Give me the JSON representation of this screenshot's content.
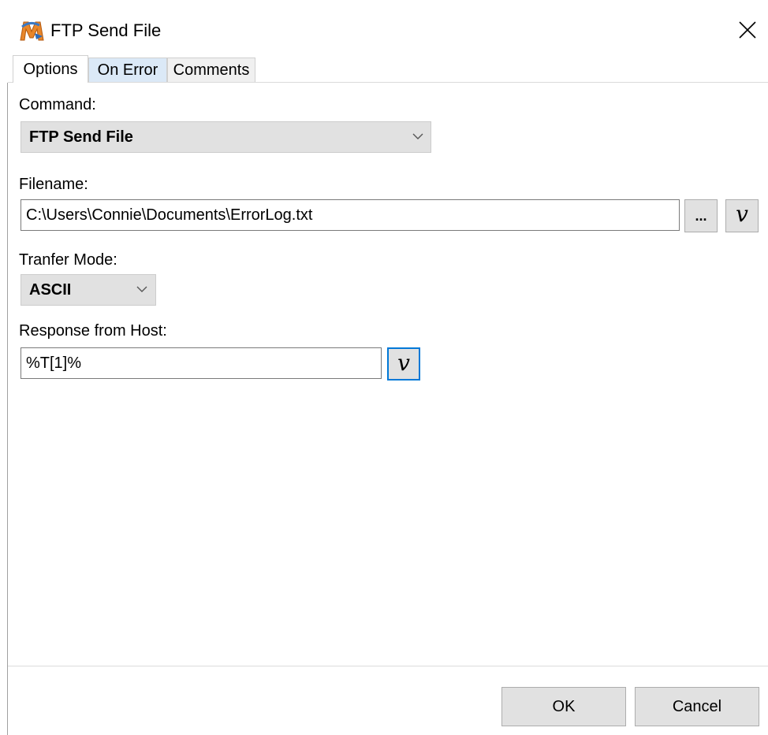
{
  "window": {
    "title": "FTP Send File",
    "icon": "macro-m-icon"
  },
  "tabs": [
    {
      "label": "Options",
      "active": true
    },
    {
      "label": "On Error",
      "active": false
    },
    {
      "label": "Comments",
      "active": false
    }
  ],
  "form": {
    "command_label": "Command:",
    "command_value": "FTP Send File",
    "filename_label": "Filename:",
    "filename_value": "C:\\Users\\Connie\\Documents\\ErrorLog.txt",
    "browse_label": "...",
    "variable_label": "v",
    "transfer_mode_label": "Tranfer Mode:",
    "transfer_mode_value": "ASCII",
    "response_label": "Response from Host:",
    "response_value": "%T[1]%"
  },
  "buttons": {
    "ok": "OK",
    "cancel": "Cancel"
  },
  "colors": {
    "focus_border": "#0078d7",
    "button_bg": "#e1e1e1",
    "tab_hover_bg": "#dbe9f7"
  }
}
